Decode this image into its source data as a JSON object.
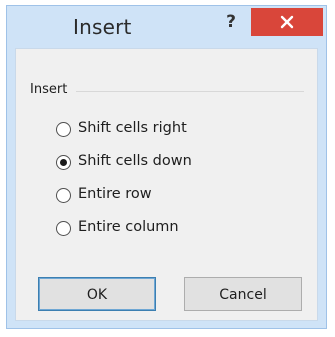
{
  "dialog": {
    "title": "Insert",
    "help_label": "?",
    "group_label": "Insert",
    "options": [
      {
        "label": "Shift cells right",
        "checked": false
      },
      {
        "label": "Shift cells down",
        "checked": true
      },
      {
        "label": "Entire row",
        "checked": false
      },
      {
        "label": "Entire column",
        "checked": false
      }
    ],
    "ok_label": "OK",
    "cancel_label": "Cancel"
  },
  "colors": {
    "title_bar": "#cfe3f7",
    "close_button": "#d9463a",
    "dialog_body": "#f0f0f0"
  },
  "icons": {
    "close": "close-icon",
    "help": "help-icon"
  }
}
